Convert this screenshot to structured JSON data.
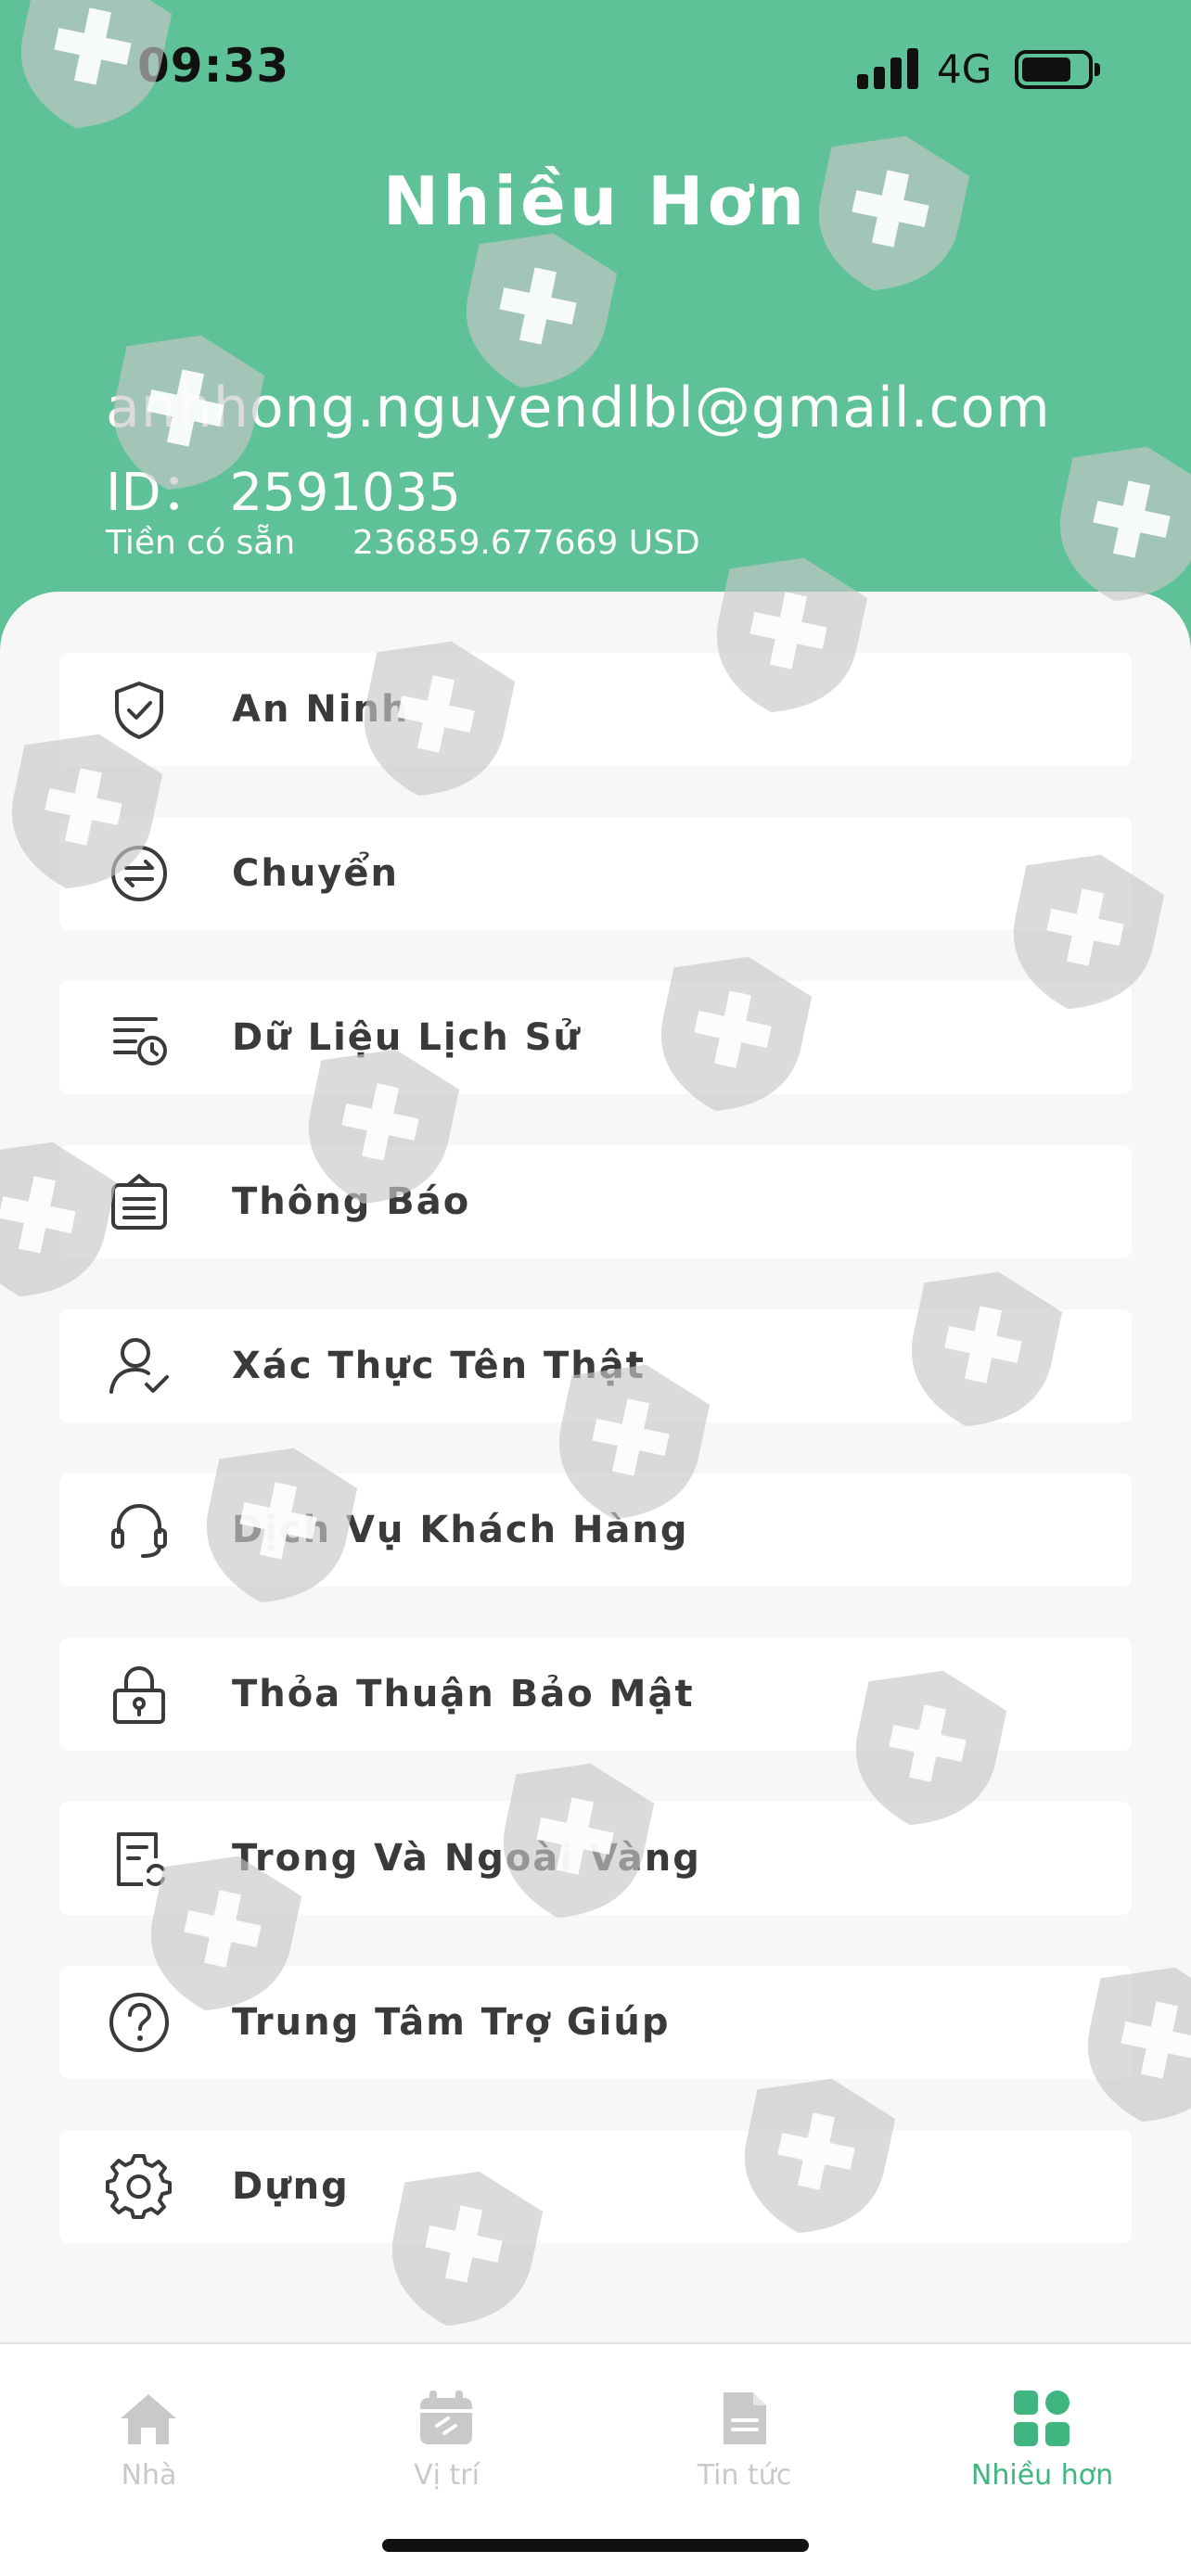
{
  "status_bar": {
    "time": "09:33",
    "network": "4G"
  },
  "header": {
    "title": "Nhiều Hơn",
    "email": "anhhong.nguyendlbl@gmail.com",
    "id_line": "ID： 2591035",
    "available_label": "Tiền có sẵn",
    "available_amount": "236859.677669 USD"
  },
  "menu": [
    {
      "label": "An Ninh",
      "icon": "shield-check-icon"
    },
    {
      "label": "Chuyển",
      "icon": "transfer-arrows-icon"
    },
    {
      "label": "Dữ Liệu Lịch Sử",
      "icon": "history-list-icon"
    },
    {
      "label": "Thông Báo",
      "icon": "notice-board-icon"
    },
    {
      "label": "Xác Thực Tên Thật",
      "icon": "user-verified-icon"
    },
    {
      "label": "Dịch Vụ Khách Hàng",
      "icon": "headset-icon"
    },
    {
      "label": "Thỏa Thuận Bảo Mật",
      "icon": "lock-icon"
    },
    {
      "label": "Trong Và Ngoài Vàng",
      "icon": "document-refresh-icon"
    },
    {
      "label": "Trung Tâm Trợ Giúp",
      "icon": "question-circle-icon"
    },
    {
      "label": "Dựng",
      "icon": "gear-icon"
    }
  ],
  "tabbar": [
    {
      "label": "Nhà",
      "icon": "home-icon",
      "active": false
    },
    {
      "label": "Vị trí",
      "icon": "calendar-position-icon",
      "active": false
    },
    {
      "label": "Tin tức",
      "icon": "news-document-icon",
      "active": false
    },
    {
      "label": "Nhiều hơn",
      "icon": "grid-more-icon",
      "active": true
    }
  ],
  "colors": {
    "header_bg": "#5ec197",
    "accent": "#3fb57f",
    "inactive": "#c9c9c9",
    "text": "#3a3a3a"
  }
}
